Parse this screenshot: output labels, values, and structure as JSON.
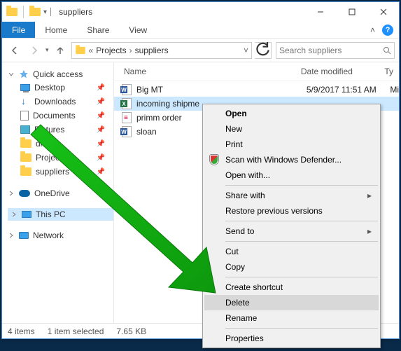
{
  "title": "suppliers",
  "tabs": {
    "file": "File",
    "home": "Home",
    "share": "Share",
    "view": "View"
  },
  "breadcrumb": {
    "parent": "Projects",
    "current": "suppliers"
  },
  "search": {
    "placeholder": "Search suppliers"
  },
  "sidebar": {
    "quick": "Quick access",
    "items": [
      "Desktop",
      "Downloads",
      "Documents",
      "Pictures",
      "drafts",
      "Projects",
      "suppliers"
    ],
    "onedrive": "OneDrive",
    "thispc": "This PC",
    "network": "Network"
  },
  "columns": {
    "name": "Name",
    "date": "Date modified",
    "type": "Ty"
  },
  "files": [
    {
      "name": "Big MT",
      "date": "5/9/2017 11:51 AM",
      "type": "Mi",
      "kind": "word"
    },
    {
      "name": "incoming shipme",
      "date": "",
      "type": "",
      "kind": "excel",
      "selected": true
    },
    {
      "name": "primm order",
      "date": "",
      "type": "",
      "kind": "pdf"
    },
    {
      "name": "sloan",
      "date": "",
      "type": "",
      "kind": "word"
    }
  ],
  "status": {
    "count": "4 items",
    "selected": "1 item selected",
    "size": "7.65 KB"
  },
  "ctx": {
    "open": "Open",
    "new": "New",
    "print": "Print",
    "defender": "Scan with Windows Defender...",
    "openwith": "Open with...",
    "sharewith": "Share with",
    "restore": "Restore previous versions",
    "sendto": "Send to",
    "cut": "Cut",
    "copy": "Copy",
    "shortcut": "Create shortcut",
    "delete": "Delete",
    "rename": "Rename",
    "properties": "Properties"
  }
}
